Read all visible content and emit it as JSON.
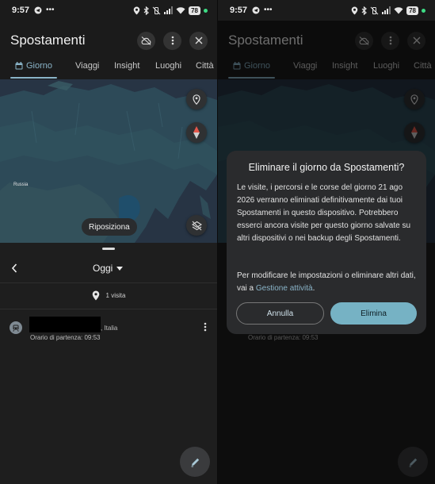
{
  "status_bar": {
    "time": "9:57",
    "battery": "78"
  },
  "app": {
    "title": "Spostamenti"
  },
  "tabs": [
    {
      "label": "Giorno"
    },
    {
      "label": "Viaggi"
    },
    {
      "label": "Insight"
    },
    {
      "label": "Luoghi"
    },
    {
      "label": "Città"
    }
  ],
  "map": {
    "country_label": "Russia",
    "recenter_label": "Riposiziona"
  },
  "day": {
    "date_label": "Oggi",
    "visits_count": "1 visita"
  },
  "timeline": [
    {
      "country": ", Italia",
      "departure": "Orario di partenza: 09:53"
    }
  ],
  "dialog": {
    "title": "Eliminare il giorno da Spostamenti?",
    "body": "Le visite, i percorsi e le corse del giorno 21 ago 2026 verranno eliminati definitivamente dai tuoi Spostamenti in questo dispositivo. Potrebbero esserci ancora visite per questo giorno salvate su altri dispositivi o nei backup degli Spostamenti.",
    "body2_prefix": "Per modificare le impostazioni o eliminare altri dati, vai a ",
    "body2_link": "Gestione attività",
    "body2_suffix": ".",
    "cancel_label": "Annulla",
    "confirm_label": "Elimina"
  },
  "colors": {
    "accent": "#8ab4c8",
    "confirm_button": "#76b2c4",
    "map_land": "#2d4a58",
    "map_water": "#273444"
  }
}
